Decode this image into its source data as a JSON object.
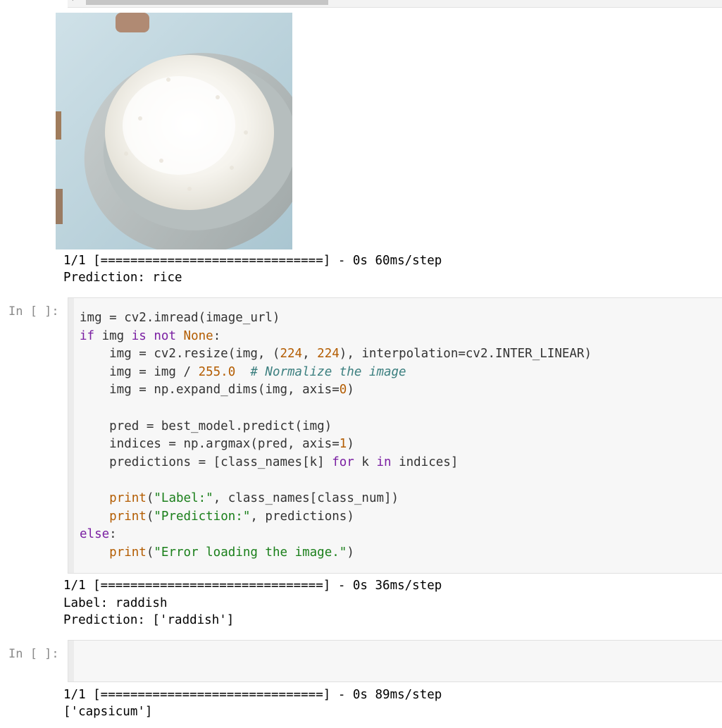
{
  "top_output": {
    "image_alt": "plate of white rice",
    "progress_line": "1/1 [==============================] - 0s 60ms/step",
    "prediction_line": "Prediction: rice"
  },
  "cell1": {
    "prompt": "In [ ]:",
    "code": [
      "img = cv2.imread(image_url)",
      "if img is not None:",
      "    img = cv2.resize(img, (224, 224), interpolation=cv2.INTER_LINEAR)",
      "    img = img / 255.0  # Normalize the image",
      "    img = np.expand_dims(img, axis=0)",
      "",
      "    pred = best_model.predict(img)",
      "    indices = np.argmax(pred, axis=1)",
      "    predictions = [class_names[k] for k in indices]",
      "",
      "    print(\"Label:\", class_names[class_num])",
      "    print(\"Prediction:\", predictions)",
      "else:",
      "    print(\"Error loading the image.\")"
    ],
    "output": {
      "progress_line": "1/1 [==============================] - 0s 36ms/step",
      "label_line": "Label: raddish",
      "prediction_line": "Prediction: ['raddish']"
    }
  },
  "cell2": {
    "prompt": "In [ ]:",
    "output": {
      "progress_line": "1/1 [==============================] - 0s 89ms/step",
      "result_line": "['capsicum']"
    }
  },
  "colors": {
    "keyword": "#7a1fa2",
    "number": "#b35c00",
    "string": "#1a7f1a",
    "comment": "#3b7f7f",
    "cell_bg": "#f7f7f7"
  }
}
